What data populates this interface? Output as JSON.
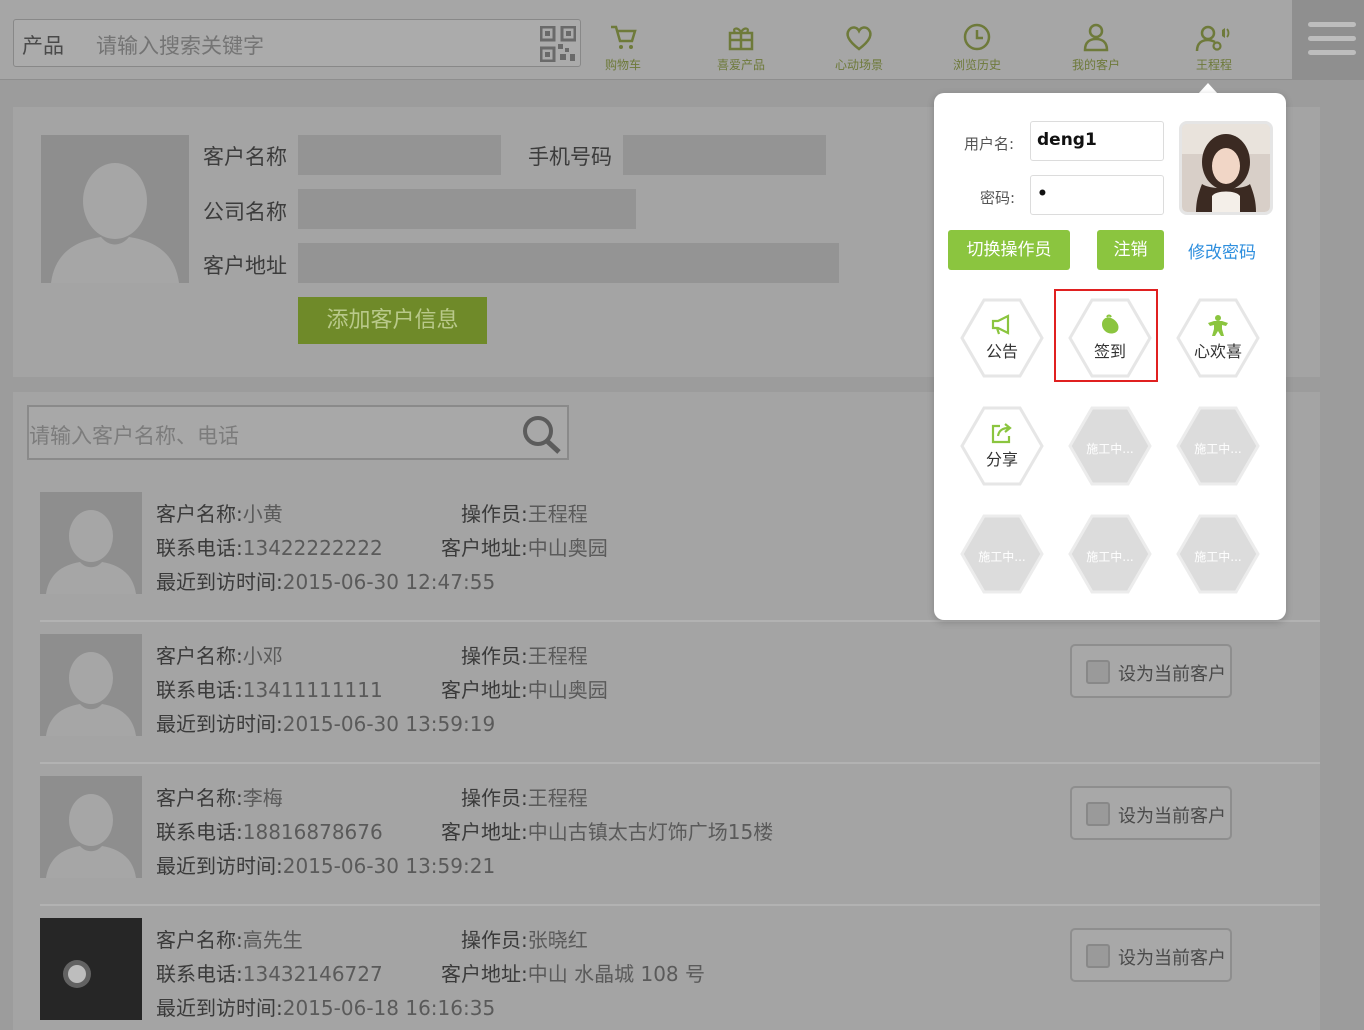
{
  "topbar": {
    "search_category": "产品",
    "search_placeholder": "请输入搜索关键字",
    "nav": [
      {
        "label": "购物车",
        "icon": "cart-icon"
      },
      {
        "label": "喜爱产品",
        "icon": "gift-icon"
      },
      {
        "label": "心动场景",
        "icon": "heart-icon"
      },
      {
        "label": "浏览历史",
        "icon": "clock-icon"
      },
      {
        "label": "我的客户",
        "icon": "user-icon"
      },
      {
        "label": "王程程",
        "icon": "user-settings-icon"
      }
    ]
  },
  "form": {
    "customer_name_label": "客户名称",
    "phone_label": "手机号码",
    "company_label": "公司名称",
    "address_label": "客户地址",
    "add_button": "添加客户信息"
  },
  "list": {
    "search_placeholder": "请输入客户名称、电话",
    "labels": {
      "name": "客户名称:",
      "operator": "操作员:",
      "phone": "联系电话:",
      "address": "客户地址:",
      "last_visit": "最近到访时间:"
    },
    "set_button": "设为当前客户",
    "rows": [
      {
        "name": "小黄",
        "operator": "王程程",
        "phone": "13422222222",
        "address": "中山奥园",
        "last_visit": "2015-06-30 12:47:55"
      },
      {
        "name": "小邓",
        "operator": "王程程",
        "phone": "13411111111",
        "address": "中山奥园",
        "last_visit": "2015-06-30 13:59:19"
      },
      {
        "name": "李梅",
        "operator": "王程程",
        "phone": "18816878676",
        "address": "中山古镇太古灯饰广场15楼",
        "last_visit": "2015-06-30 13:59:21"
      },
      {
        "name": "高先生",
        "operator": "张晓红",
        "phone": "13432146727",
        "address": "中山 水晶城 108 号",
        "last_visit": "2015-06-18 16:16:35"
      }
    ]
  },
  "popover": {
    "username_label": "用户名:",
    "username_value": "deng1",
    "password_label": "密码:",
    "password_value": "•",
    "switch_button": "切换操作员",
    "logout_button": "注销",
    "change_password_link": "修改密码",
    "tiles": [
      {
        "label": "公告",
        "icon": "megaphone-icon"
      },
      {
        "label": "签到",
        "icon": "checkin-icon"
      },
      {
        "label": "心欢喜",
        "icon": "person-icon"
      },
      {
        "label": "分享",
        "icon": "share-icon"
      },
      {
        "label": "施工中...",
        "icon": "under-construction-icon"
      },
      {
        "label": "施工中...",
        "icon": "under-construction-icon"
      },
      {
        "label": "施工中...",
        "icon": "under-construction-icon"
      },
      {
        "label": "施工中...",
        "icon": "under-construction-icon"
      },
      {
        "label": "施工中...",
        "icon": "under-construction-icon"
      }
    ]
  },
  "colors": {
    "accent_green": "#8bc53f",
    "link_blue": "#2f8fde",
    "highlight_red": "#e02020",
    "overlay_gray": "#9c9c9c"
  }
}
